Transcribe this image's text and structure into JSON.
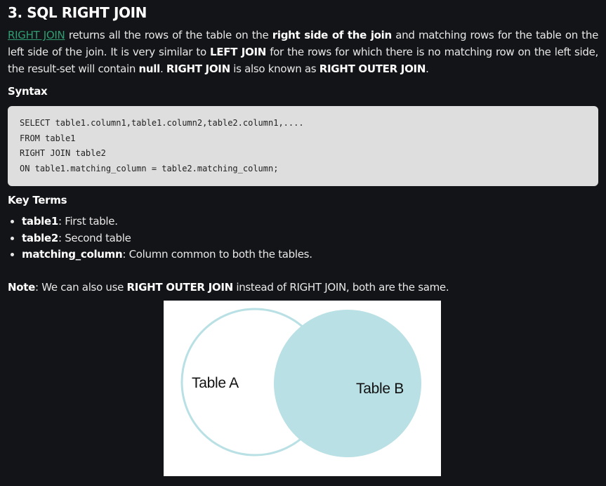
{
  "article": {
    "title": "3. SQL RIGHT JOIN",
    "intro": {
      "link_text": "RIGHT JOIN",
      "t1": " returns all the rows of the table on the ",
      "b1": "right side of the join",
      "t2": " and matching rows for the table on the left side of the join. It is very similar to ",
      "b2": "LEFT JOIN",
      "t3": " for the rows for which there is no matching row on the left side, the result-set will contain ",
      "b3": "null",
      "t4": ". ",
      "b4": "RIGHT JOIN",
      "t5": " is also known as ",
      "b5": "RIGHT OUTER JOIN",
      "t6": "."
    },
    "syntax_heading": "Syntax",
    "code_lines": [
      "SELECT table1.column1,table1.column2,table2.column1,....",
      "FROM table1",
      "RIGHT JOIN table2",
      "ON table1.matching_column = table2.matching_column;"
    ],
    "key_terms_heading": "Key Terms",
    "terms": [
      {
        "term": "table1",
        "desc": ": First table."
      },
      {
        "term": "table2",
        "desc": ": Second table"
      },
      {
        "term": "matching_column",
        "desc": ": Column common to both the tables."
      }
    ],
    "note": {
      "label": "Note",
      "t1": ": We can also use ",
      "b1": "RIGHT OUTER JOIN",
      "t2": " instead of RIGHT JOIN, both are the same."
    },
    "diagram": {
      "left_label": "Table A",
      "right_label": "Table B",
      "left_stroke": "#b9e0e4",
      "right_fill": "#b9e0e4"
    }
  }
}
